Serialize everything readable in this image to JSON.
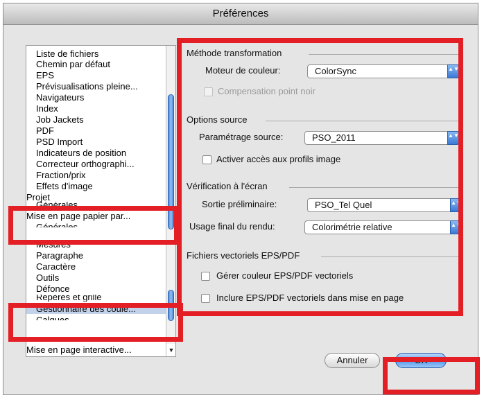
{
  "window": {
    "title": "Préférences"
  },
  "sidebar": {
    "items": [
      "Liste de fichiers",
      "Chemin par défaut",
      "EPS",
      "Prévisualisations pleine...",
      "Navigateurs",
      "Index",
      "Job Jackets",
      "PDF",
      "PSD Import",
      "Indicateurs de position",
      "Correcteur orthographi...",
      "Fraction/prix",
      "Effets d'image",
      "Projet",
      "Générales",
      "Mise en page papier par...",
      "Générales",
      "Mesures",
      "Paragraphe",
      "Caractère",
      "Outils",
      "Défonce",
      "Repères et grille",
      "Gestionnaire des coule...",
      "Calques",
      "Mise en page interactive..."
    ],
    "popup_arrow_glyph": "▼"
  },
  "sections": {
    "transform": {
      "title": "Méthode transformation",
      "engine_label": "Moteur de couleur:",
      "engine_value": "ColorSync",
      "blackpoint_label": "Compensation point noir"
    },
    "source": {
      "title": "Options source",
      "setting_label": "Paramétrage source:",
      "setting_value": "PSO_2011",
      "profiles_label": "Activer accès aux profils image"
    },
    "proof": {
      "title": "Vérification à l'écran",
      "output_label": "Sortie préliminaire:",
      "output_value": "PSO_Tel Quel",
      "intent_label": "Usage final du rendu:",
      "intent_value": "Colorimétrie relative"
    },
    "vector": {
      "title": "Fichiers vectoriels EPS/PDF",
      "manage_label": "Gérer couleur EPS/PDF vectoriels",
      "include_label": "Inclure EPS/PDF vectoriels dans mise en page"
    }
  },
  "buttons": {
    "cancel": "Annuler",
    "ok": "OK"
  },
  "stepper_glyph": "▲▼",
  "colors": {
    "highlight": "#e31e24",
    "selection": "#c2d2ea",
    "accent": "#3b79d6"
  }
}
